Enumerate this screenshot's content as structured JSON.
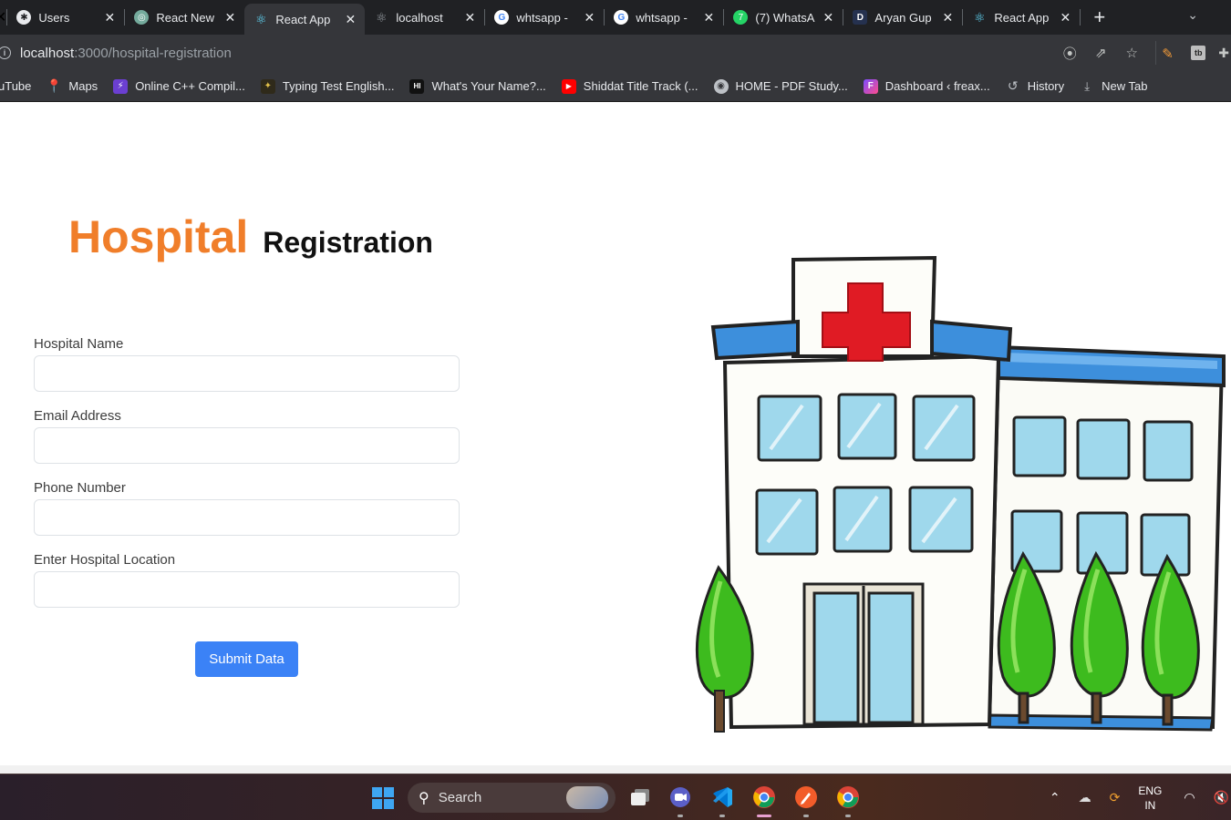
{
  "browser": {
    "tabs": [
      {
        "title": "Users",
        "icon": "user-shield-icon",
        "icon_color": "#e8eaed"
      },
      {
        "title": "React New",
        "icon": "chatgpt-icon",
        "icon_color": "#74aa9c"
      },
      {
        "title": "React App",
        "icon": "react-icon",
        "icon_color": "#61dafb",
        "active": true
      },
      {
        "title": "localhost",
        "icon": "react-icon",
        "icon_color": "#9aa0a6"
      },
      {
        "title": "whtsapp -",
        "icon": "google-icon",
        "icon_color": "#ffffff"
      },
      {
        "title": "whtsapp -",
        "icon": "google-icon",
        "icon_color": "#ffffff"
      },
      {
        "title": "(7) WhatsA",
        "icon": "whatsapp-icon",
        "icon_color": "#25d366"
      },
      {
        "title": "Aryan Gup",
        "icon": "letter-d-icon",
        "icon_color": "#3c4f9e"
      },
      {
        "title": "React App",
        "icon": "react-icon",
        "icon_color": "#61dafb"
      }
    ],
    "url": {
      "host": "localhost",
      "path": ":3000/hospital-registration"
    },
    "bookmarks": [
      {
        "label": "uTube",
        "icon": "youtube-icon"
      },
      {
        "label": "Maps",
        "icon": "maps-pin-icon"
      },
      {
        "label": "Online C++ Compil...",
        "icon": "bolt-icon"
      },
      {
        "label": "Typing Test English...",
        "icon": "typing-icon"
      },
      {
        "label": "What's Your Name?...",
        "icon": "hi-icon"
      },
      {
        "label": "Shiddat Title Track (...",
        "icon": "youtube-icon"
      },
      {
        "label": "HOME - PDF Study...",
        "icon": "globe-icon"
      },
      {
        "label": "Dashboard ‹ freax...",
        "icon": "f-logo-icon"
      },
      {
        "label": "History",
        "icon": "history-icon"
      },
      {
        "label": "New Tab",
        "icon": "download-icon"
      }
    ]
  },
  "page": {
    "heading_orange": "Hospital",
    "heading_black": "Registration",
    "fields": [
      {
        "label": "Hospital Name",
        "value": ""
      },
      {
        "label": "Email Address",
        "value": ""
      },
      {
        "label": "Phone Number",
        "value": ""
      },
      {
        "label": "Enter Hospital Location",
        "value": ""
      }
    ],
    "submit_label": "Submit Data"
  },
  "taskbar": {
    "search_label": "Search",
    "lang_line1": "ENG",
    "lang_line2": "IN"
  },
  "colors": {
    "accent_orange": "#f07e2a",
    "button_blue": "#3b82f6"
  }
}
